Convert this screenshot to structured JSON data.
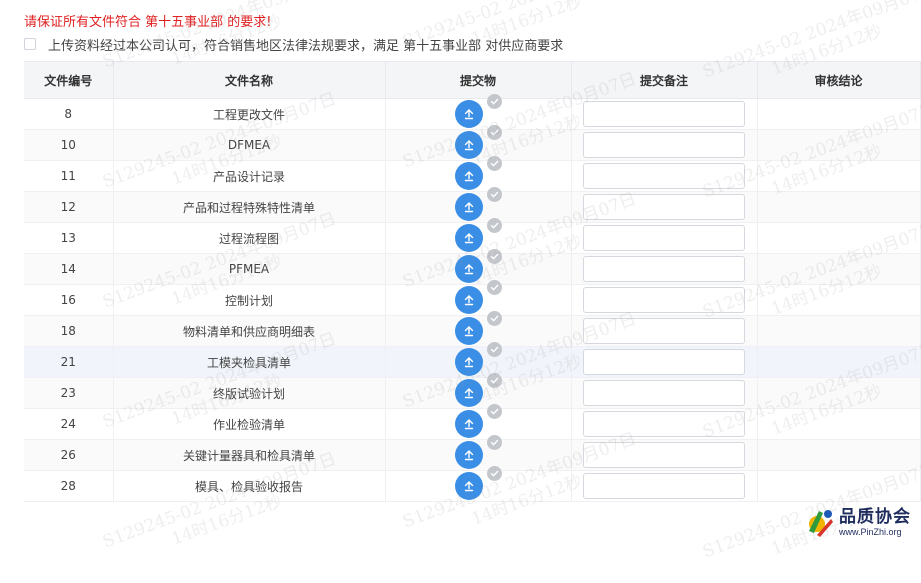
{
  "notice": {
    "warning": "请保证所有文件符合 第十五事业部 的要求!",
    "agreement": "上传资料经过本公司认可，符合销售地区法律法规要求，满足 第十五事业部 对供应商要求"
  },
  "table": {
    "headers": [
      "文件编号",
      "文件名称",
      "提交物",
      "提交备注",
      "审核结论"
    ],
    "rows": [
      {
        "no": "8",
        "name": "工程更改文件"
      },
      {
        "no": "10",
        "name": "DFMEA"
      },
      {
        "no": "11",
        "name": "产品设计记录"
      },
      {
        "no": "12",
        "name": "产品和过程特殊特性清单"
      },
      {
        "no": "13",
        "name": "过程流程图"
      },
      {
        "no": "14",
        "name": "PFMEA"
      },
      {
        "no": "16",
        "name": "控制计划"
      },
      {
        "no": "18",
        "name": "物料清单和供应商明细表"
      },
      {
        "no": "21",
        "name": "工模夹检具清单"
      },
      {
        "no": "23",
        "name": "终版试验计划"
      },
      {
        "no": "24",
        "name": "作业检验清单"
      },
      {
        "no": "26",
        "name": "关键计量器具和检具清单"
      },
      {
        "no": "28",
        "name": "模具、检具验收报告"
      }
    ]
  },
  "watermark": {
    "line1": "S129245-02 2024年09月07日",
    "line2": "14时16分12秒"
  },
  "logo": {
    "title": "品质协会",
    "url": "www.PinZhi.org"
  },
  "colors": {
    "warning": "#e02020",
    "upload": "#3a8ee6",
    "check": "#c3c6cb"
  },
  "icons": {
    "upload": "upload-arrow-icon",
    "check": "check-circle-icon"
  }
}
